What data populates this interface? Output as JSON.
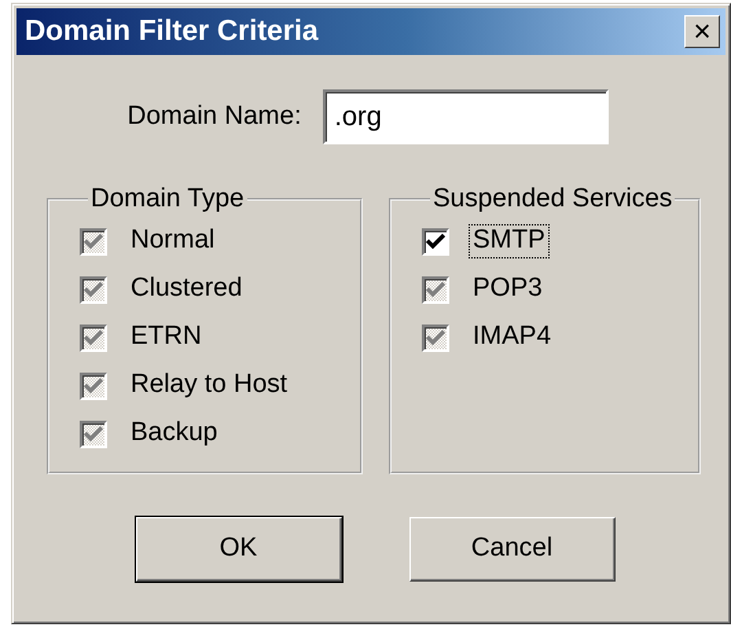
{
  "window": {
    "title": "Domain Filter Criteria",
    "close": "×"
  },
  "domain_name": {
    "label": "Domain Name:",
    "value": ".org"
  },
  "groups": [
    {
      "title": "Domain Type",
      "options": [
        {
          "label": "Normal",
          "checked": true,
          "disabled": true,
          "focused": false
        },
        {
          "label": "Clustered",
          "checked": true,
          "disabled": true,
          "focused": false
        },
        {
          "label": "ETRN",
          "checked": true,
          "disabled": true,
          "focused": false
        },
        {
          "label": "Relay to Host",
          "checked": true,
          "disabled": true,
          "focused": false
        },
        {
          "label": "Backup",
          "checked": true,
          "disabled": true,
          "focused": false
        }
      ]
    },
    {
      "title": "Suspended Services",
      "options": [
        {
          "label": "SMTP",
          "checked": true,
          "disabled": false,
          "focused": true
        },
        {
          "label": "POP3",
          "checked": true,
          "disabled": true,
          "focused": false
        },
        {
          "label": "IMAP4",
          "checked": true,
          "disabled": true,
          "focused": false
        }
      ]
    }
  ],
  "buttons": [
    {
      "label": "OK",
      "default": true
    },
    {
      "label": "Cancel",
      "default": false
    }
  ]
}
